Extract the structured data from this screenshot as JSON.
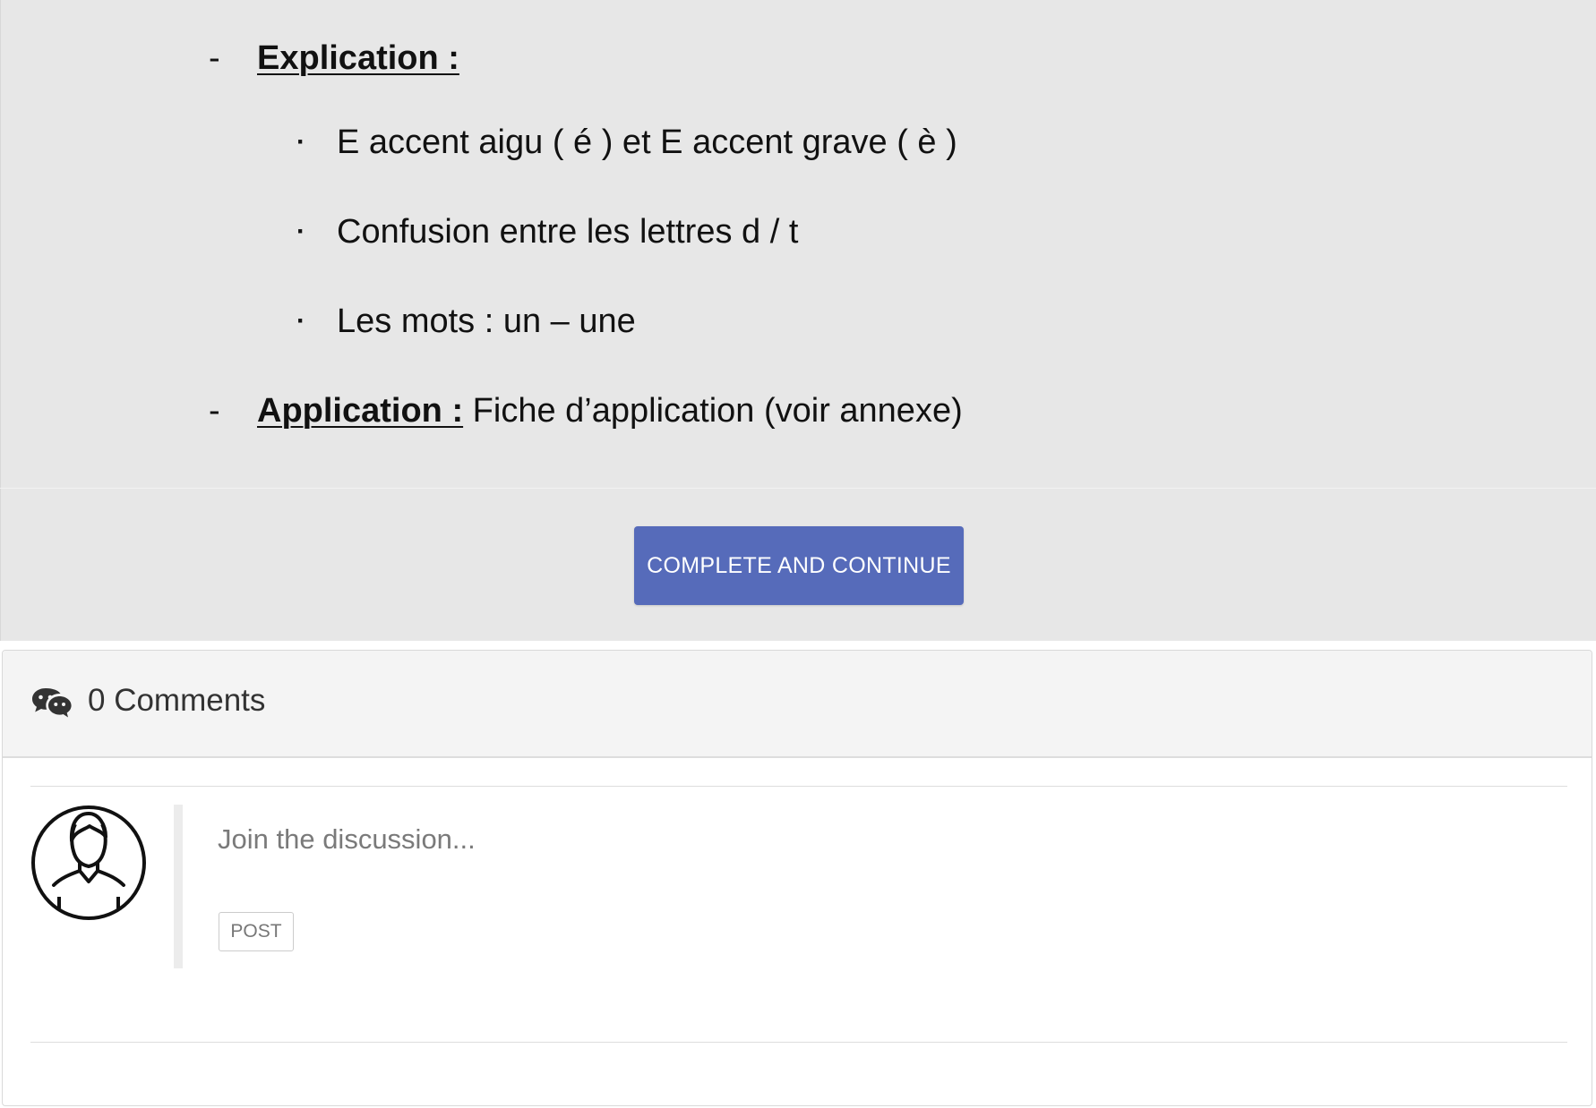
{
  "lesson": {
    "explication": {
      "bullet": "-",
      "heading": "Explication :",
      "items": [
        {
          "bullet": "·",
          "text": "E accent aigu ( é ) et E accent grave ( è )"
        },
        {
          "bullet": "·",
          "text": "Confusion entre les lettres d / t"
        },
        {
          "bullet": "·",
          "text": "Les mots : un – une"
        }
      ]
    },
    "application": {
      "bullet": "-",
      "heading": "Application :",
      "text": " Fiche d’application (voir annexe)"
    }
  },
  "actions": {
    "complete_label": "COMPLETE AND CONTINUE",
    "accent_color": "#566bba"
  },
  "comments": {
    "icon": "comments-icon",
    "count_label": "0 Comments",
    "avatar_icon": "user-avatar-icon",
    "input_placeholder": "Join the discussion...",
    "post_label": "POST"
  }
}
